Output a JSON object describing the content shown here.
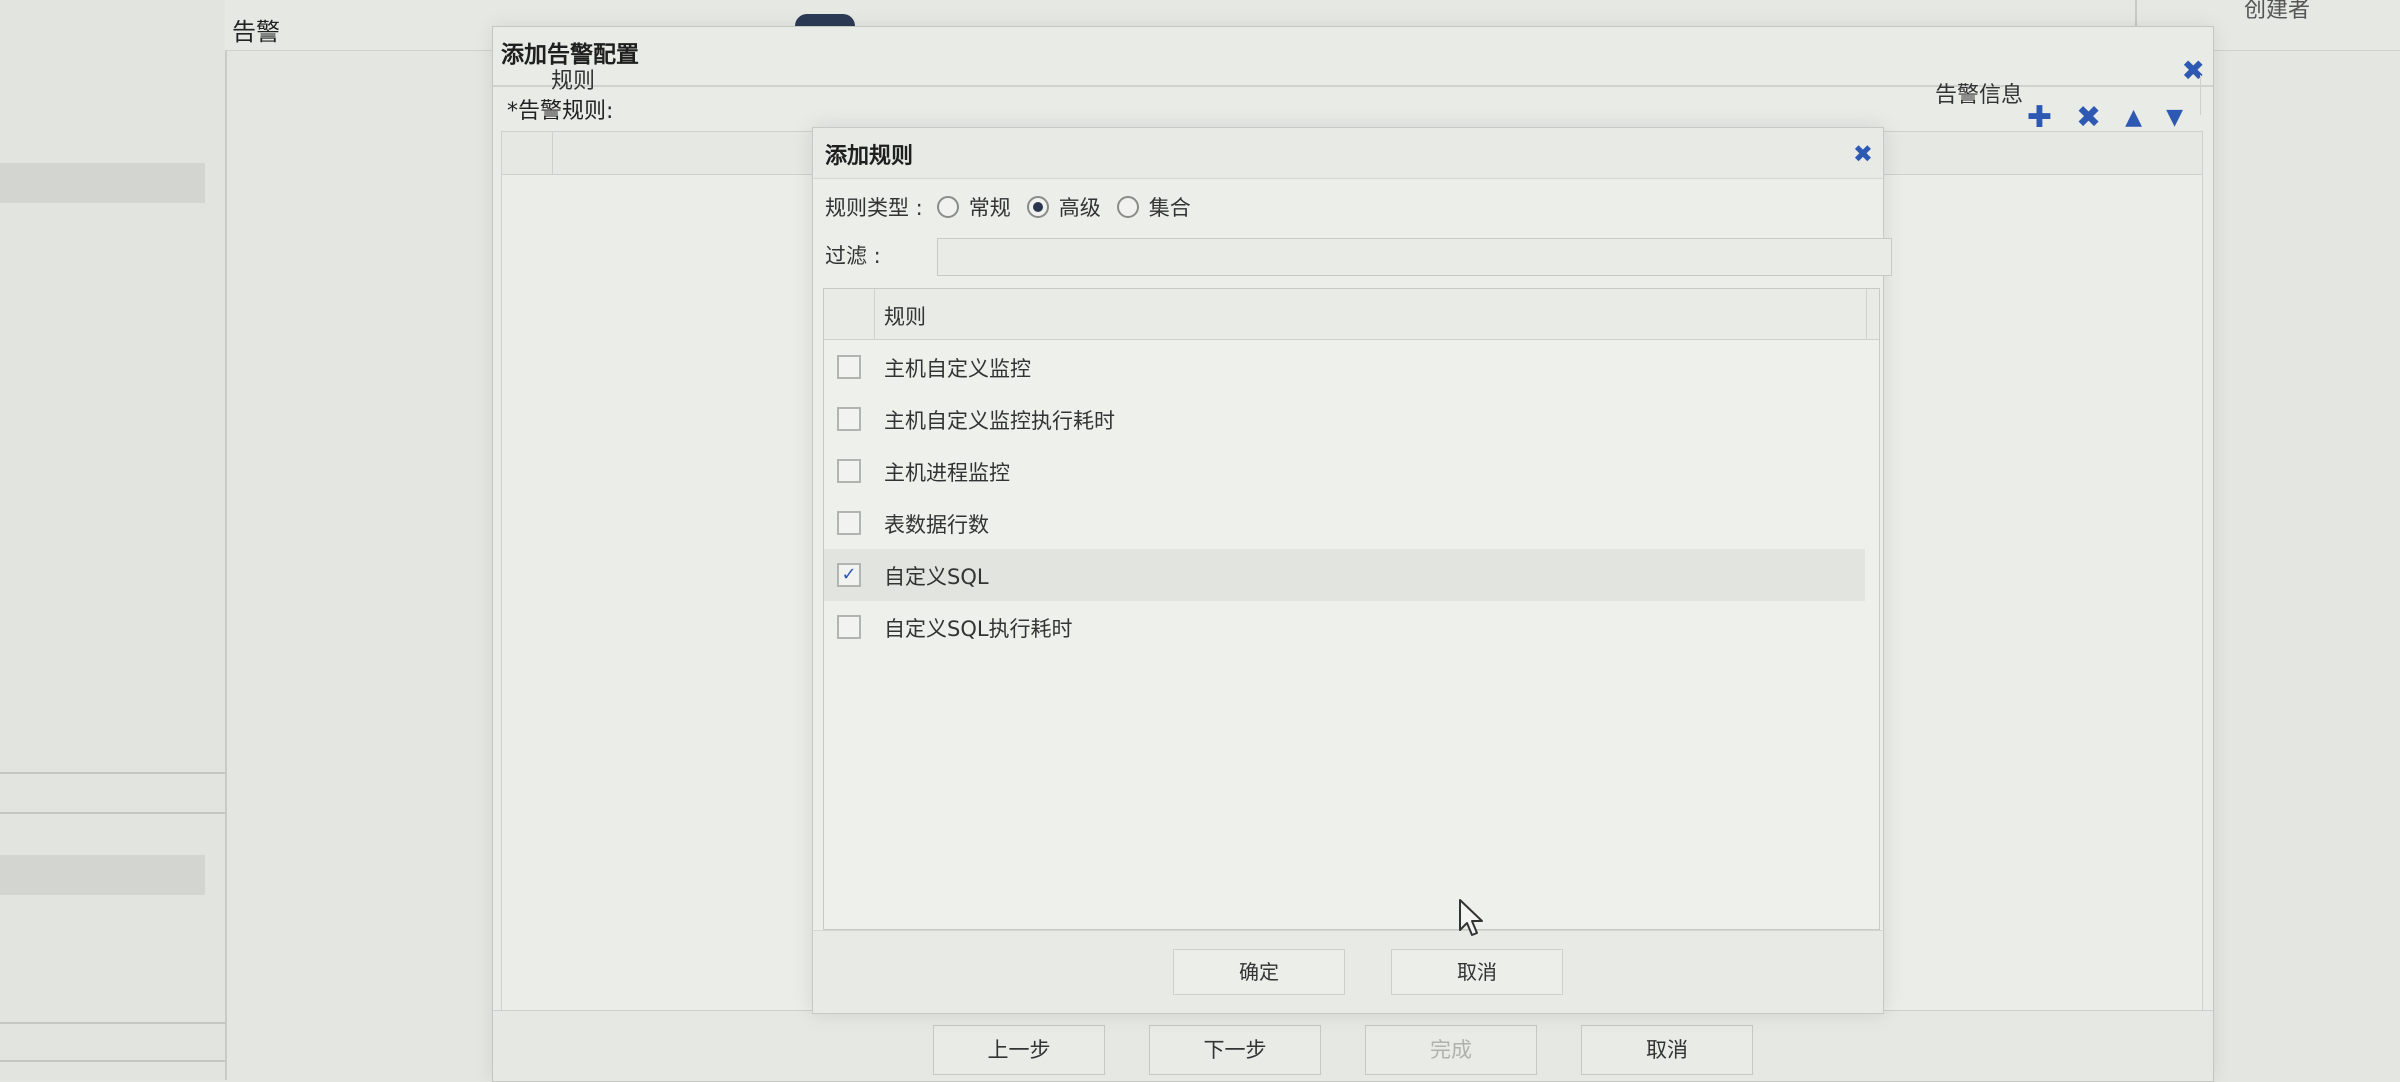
{
  "background": {
    "nav_label": "告警",
    "column_creator": "创建者"
  },
  "outer_dialog": {
    "title": "添加告警配置",
    "close_icon": "close-icon",
    "rules_label": "*告警规则:",
    "toolbar": {
      "add_icon": "plus-icon",
      "delete_icon": "x-icon",
      "up_icon": "triangle-up-icon",
      "down_icon": "triangle-down-icon"
    },
    "columns": {
      "rule": "规则",
      "alert_message": "告警信息"
    },
    "buttons": {
      "prev": "上一步",
      "next": "下一步",
      "finish": "完成",
      "cancel": "取消"
    }
  },
  "inner_dialog": {
    "title": "添加规则",
    "rule_type_label": "规则类型 :",
    "rule_types": [
      {
        "label": "常规",
        "selected": false
      },
      {
        "label": "高级",
        "selected": true
      },
      {
        "label": "集合",
        "selected": false
      }
    ],
    "filter_label": "过滤 :",
    "filter_value": "",
    "list_header": "规则",
    "rules": [
      {
        "name": "主机自定义监控",
        "checked": false
      },
      {
        "name": "主机自定义监控执行耗时",
        "checked": false
      },
      {
        "name": "主机进程监控",
        "checked": false
      },
      {
        "name": "表数据行数",
        "checked": false
      },
      {
        "name": "自定义SQL",
        "checked": true
      },
      {
        "name": "自定义SQL执行耗时",
        "checked": false
      }
    ],
    "buttons": {
      "confirm": "确定",
      "cancel": "取消"
    }
  },
  "colors": {
    "accent": "#2e59b3",
    "radio_dot": "#2b3550"
  }
}
